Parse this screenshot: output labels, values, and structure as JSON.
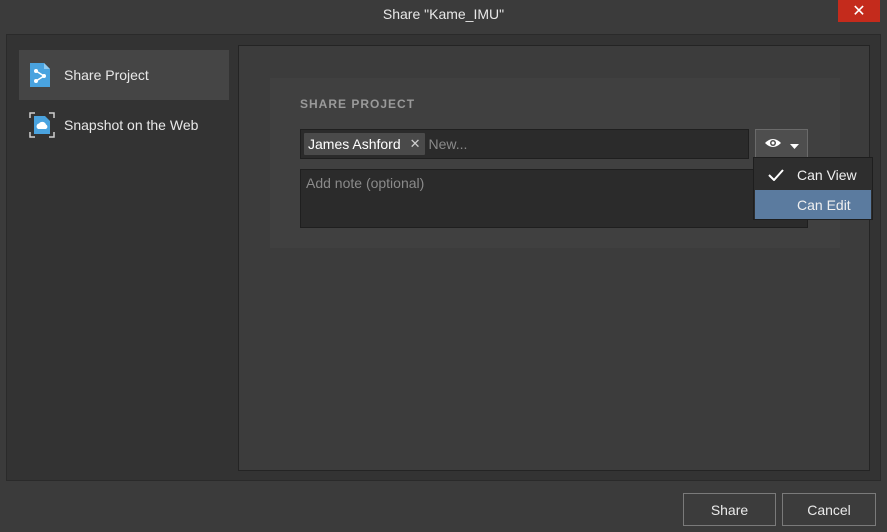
{
  "window": {
    "title": "Share \"Kame_IMU\"",
    "close_glyph": "✕"
  },
  "sidebar": {
    "items": [
      {
        "label": "Share Project",
        "icon": "share-project-icon",
        "active": true
      },
      {
        "label": "Snapshot on the Web",
        "icon": "cloud-snapshot-icon",
        "active": false
      }
    ]
  },
  "share": {
    "section_title": "SHARE PROJECT",
    "recipients": [
      {
        "name": "James Ashford",
        "remove_glyph": "✕"
      }
    ],
    "new_placeholder": "New...",
    "note_placeholder": "Add note (optional)",
    "permission_icon": "eye-icon"
  },
  "permission_menu": {
    "items": [
      {
        "label": "Can View",
        "checked": true
      },
      {
        "label": "Can Edit",
        "checked": false,
        "highlighted": true
      }
    ]
  },
  "footer": {
    "share_label": "Share",
    "cancel_label": "Cancel"
  },
  "colors": {
    "accent_icon": "#4aa3df",
    "menu_highlight": "#5b7b9f",
    "close_button": "#c42b1c"
  }
}
